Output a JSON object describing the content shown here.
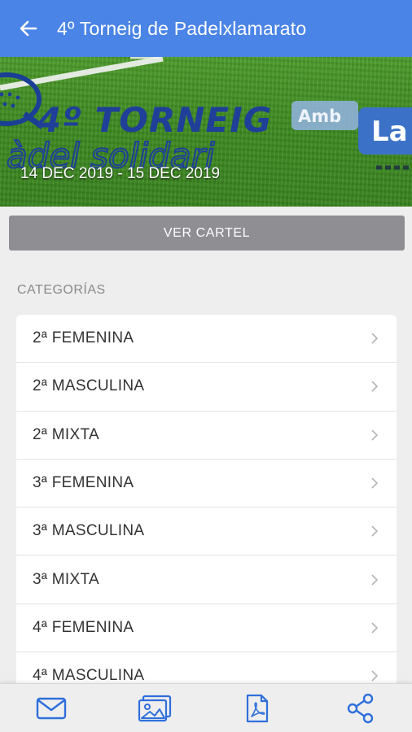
{
  "appbar": {
    "title": "4º Torneig de Padelxlamarato",
    "back_icon": "arrow-left-icon",
    "color": "#4a84e6"
  },
  "banner": {
    "headline_line1": "4º TORNEIG",
    "headline_line2": "àdel solidari",
    "tag_amb": "Amb",
    "tag_la": "La",
    "dates": "14 DEC 2019 - 15 DEC 2019"
  },
  "ver_cartel": {
    "label": "VER CARTEL"
  },
  "categories": {
    "section_label": "CATEGORÍAS",
    "items": [
      {
        "label": "2ª FEMENINA"
      },
      {
        "label": "2ª MASCULINA"
      },
      {
        "label": "2ª MIXTA"
      },
      {
        "label": "3ª FEMENINA"
      },
      {
        "label": "3ª MASCULINA"
      },
      {
        "label": "3ª MIXTA"
      },
      {
        "label": "4ª FEMENINA"
      },
      {
        "label": "4ª MASCULINA"
      }
    ]
  },
  "bottombar": {
    "tabs": [
      {
        "icon": "mail-icon"
      },
      {
        "icon": "gallery-icon"
      },
      {
        "icon": "pdf-icon"
      },
      {
        "icon": "share-icon"
      }
    ],
    "icon_color": "#2f6fdc"
  }
}
